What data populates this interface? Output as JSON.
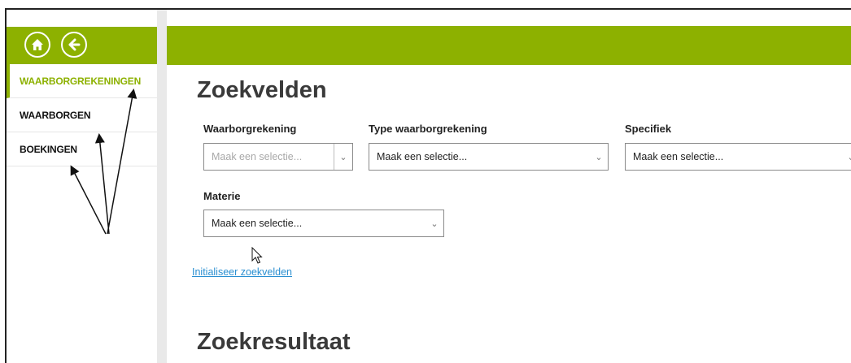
{
  "sidebar": {
    "home_icon": "home-icon",
    "back_icon": "back-arrow-icon",
    "items": [
      {
        "label": "WAARBORGREKENINGEN",
        "active": true
      },
      {
        "label": "WAARBORGEN",
        "active": false
      },
      {
        "label": "BOEKINGEN",
        "active": false
      }
    ]
  },
  "main": {
    "search_title": "Zoekvelden",
    "fields": {
      "waarborgrekening": {
        "label": "Waarborgrekening",
        "placeholder": "Maak een selectie..."
      },
      "type": {
        "label": "Type waarborgrekening",
        "value": "Maak een selectie..."
      },
      "specifiek": {
        "label": "Specifiek",
        "value": "Maak een selectie..."
      },
      "materie": {
        "label": "Materie",
        "value": "Maak een selectie..."
      }
    },
    "reset_link": "Initialiseer zoekvelden",
    "results_title": "Zoekresultaat"
  },
  "colors": {
    "accent": "#8db100",
    "link": "#2a8fd1"
  }
}
